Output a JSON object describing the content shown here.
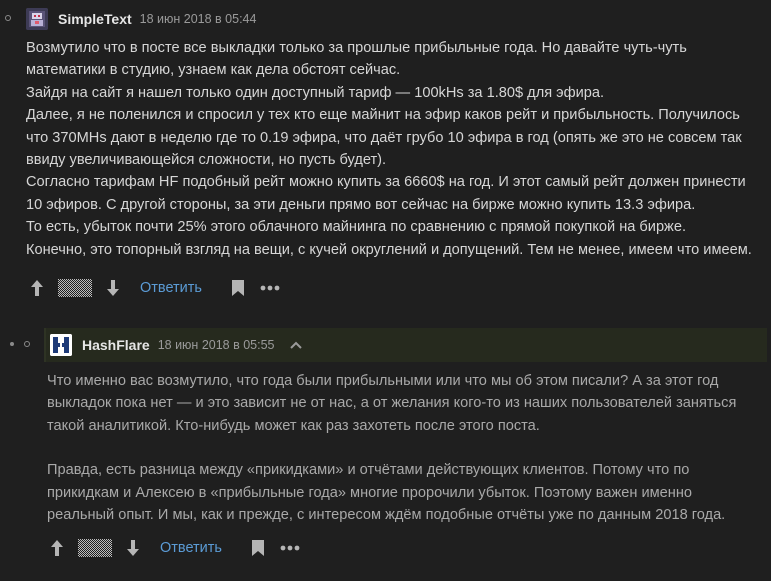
{
  "comments": [
    {
      "username": "SimpleText",
      "timestamp": "18 июн 2018 в 05:44",
      "lines": [
        "Возмутило что в посте все выкладки только за прошлые прибыльные года. Но давайте чуть-чуть",
        "математики в студию, узнаем как дела обстоят сейчас.",
        "Зайдя на сайт я нашел только один доступный тариф — 100kHs за 1.80$ для эфира.",
        "Далее, я не поленился и спросил у тех кто еще майнит на эфир каков рейт и прибыльность. Получилось",
        "что 370MHs дают в неделю где то 0.19 эфира, что даёт грубо 10 эфира в год (опять же это не совсем так",
        "ввиду увеличивающейся сложности, но пусть будет).",
        "Согласно тарифам HF подобный рейт можно купить за 6660$ на год. И этот самый рейт должен принести",
        "10 эфиров. С другой стороны, за эти деньги прямо вот сейчас на бирже можно купить 13.3 эфира.",
        "То есть, убыток почти 25% этого облачного майнинга по сравнению с прямой покупкой на бирже.",
        "Конечно, это топорный взгляд на вещи, с кучей округлений и допущений. Тем не менее, имеем что имеем."
      ],
      "reply_label": "Ответить"
    },
    {
      "username": "HashFlare",
      "timestamp": "18 июн 2018 в 05:55",
      "lines": [
        "Что именно вас возмутило, что года были прибыльными или что мы об этом писали? А за этот год",
        "выкладок пока нет — и это зависит не от нас, а от желания кого-то из наших пользователей заняться",
        "такой аналитикой. Кто-нибудь может как раз захотеть после этого поста.",
        "Правда, есть разница между «прикидками» и отчётами действующих клиентов. Потому что по",
        "прикидкам и Алексею в «прибыльные года» многие пророчили убыток. Поэтому важен именно",
        "реальный опыт. И мы, как и прежде, с интересом ждём подобные отчёты уже по данным 2018 года."
      ],
      "reply_label": "Ответить"
    }
  ],
  "icons": {
    "avatar_1": "simpletext-avatar",
    "avatar_2": "hashflare-logo-avatar",
    "vote_up": "arrow-up-icon",
    "vote_down": "arrow-down-icon",
    "rating": "hidden-rating-pattern",
    "bookmark": "bookmark-icon",
    "more": "more-dots-icon",
    "parent": "parent-comment-arrow-icon"
  },
  "colors": {
    "background": "#1f1f1f",
    "link": "#5b9bd5",
    "highlight_header": "#262a1e"
  }
}
